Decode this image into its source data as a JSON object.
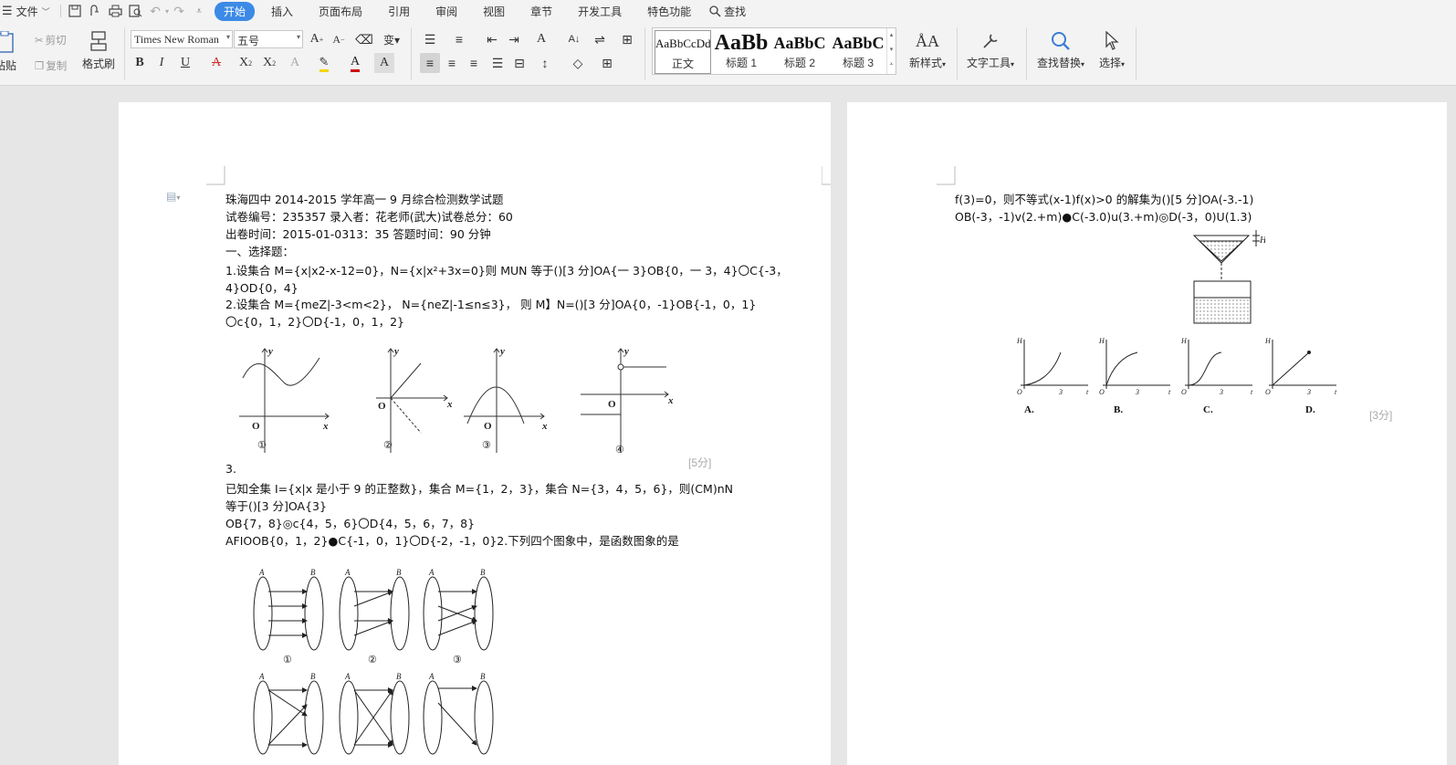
{
  "menubar": {
    "file_label": "文件",
    "tabs": [
      {
        "label": "开始",
        "active": true
      },
      {
        "label": "插入",
        "active": false
      },
      {
        "label": "页面布局",
        "active": false
      },
      {
        "label": "引用",
        "active": false
      },
      {
        "label": "审阅",
        "active": false
      },
      {
        "label": "视图",
        "active": false
      },
      {
        "label": "章节",
        "active": false
      },
      {
        "label": "开发工具",
        "active": false
      },
      {
        "label": "特色功能",
        "active": false
      }
    ],
    "search_label": "查找"
  },
  "ribbon": {
    "paste_label": "粘贴",
    "cut_label": "剪切",
    "copy_label": "复制",
    "format_painter_label": "格式刷",
    "font_name": "Times New Roman",
    "font_size": "五号",
    "styles": [
      {
        "preview": "AaBbCcDd",
        "name": "正文"
      },
      {
        "preview": "AaBb",
        "name": "标题 1"
      },
      {
        "preview": "AaBbC",
        "name": "标题 2"
      },
      {
        "preview": "AaBbC",
        "name": "标题 3"
      }
    ],
    "new_style_label": "新样式",
    "text_tools_label": "文字工具",
    "find_replace_label": "查找替换",
    "select_label": "选择"
  },
  "page1": {
    "lines": [
      "珠海四中 2014-2015 学年高一 9 月综合检测数学试题",
      "试卷编号：235357 录入者：花老师(武大)试卷总分：60",
      "出卷时间：2015-01-0313：35 答题时间：90 分钟",
      "一、选择题：",
      "1.设集合 M={x|x2-x-12=0}，N={x|x²+3x=0}则 MUN 等于()[3 分]OA{一 3}OB{0，一 3，4}〇C{-3，",
      "4}OD{0，4}",
      "2.设集合 M={meZ|-3<m<2}，  N={neZ|-1≤n≤3}，  则 M】N=()[3 分]OA{0，-1}OB{-1，0，1}",
      "〇c{0，1，2}〇D{-1，0，1，2}"
    ],
    "graph_labels": [
      "①",
      "②",
      "③",
      "④"
    ],
    "score_1": "[5分]",
    "lines_2": [
      "3.",
      "已知全集 I={x|x 是小于 9 的正整数}，集合 M={1，2，3}，集合 N={3，4，5，6}，则(CM)nN",
      "等于()[3 分]OA{3}",
      "OB{7，8}◎c{4，5，6}〇D{4，5，6，7，8}",
      "AFIOOB{0，1，2}●C{-1，0，1}〇D{-2，-1，0}2.下列四个图象中，是函数图象的是"
    ],
    "mapping_labels": [
      "①",
      "②",
      "③"
    ]
  },
  "page2": {
    "lines": [
      "f(3)=0，则不等式(x-1)f(x)>0 的解集为()[5 分]OA(-3.-1)",
      "OB(-3，-1)v(2.+m)●C(-3.0)u(3.+m)◎D(-3，0)U(1.3)"
    ],
    "choice_labels": [
      "A.",
      "B.",
      "C.",
      "D."
    ],
    "score": "[3分]"
  }
}
